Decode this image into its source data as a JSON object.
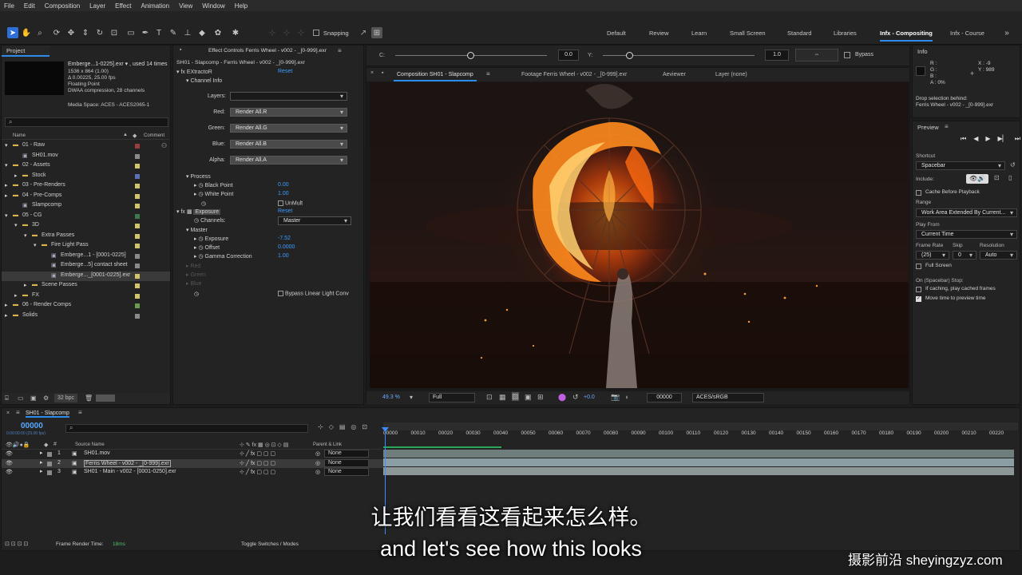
{
  "menu": [
    "File",
    "Edit",
    "Composition",
    "Layer",
    "Effect",
    "Animation",
    "View",
    "Window",
    "Help"
  ],
  "toolbar": {
    "snapping_label": "Snapping",
    "workspaces": [
      "Default",
      "Review",
      "Learn",
      "Small Screen",
      "Standard",
      "Libraries",
      "Infx - Compositing",
      "Infx - Course"
    ],
    "active_workspace": "Infx - Compositing"
  },
  "project": {
    "title": "Project",
    "item_name": "Emberge...1-0225].exr ▾ , used 14 times",
    "meta": [
      "1536 x 864 (1.00)",
      "Δ 0.00225, 25.00 fps",
      "Floating Point",
      "DWAA compression, 28 channels"
    ],
    "media_space": "Media Space: ACES - ACES2065-1",
    "search_placeholder": "",
    "col_name": "Name",
    "col_comment": "Comment",
    "bpc": "32 bpc",
    "tree": [
      {
        "label": "01 - Raw",
        "indent": 0,
        "type": "folder",
        "open": true,
        "color": "#9b3d3d"
      },
      {
        "label": "SH01.mov",
        "indent": 1,
        "type": "file",
        "color": "#8a8a8a"
      },
      {
        "label": "02 - Assets",
        "indent": 0,
        "type": "folder",
        "open": true,
        "color": "#d1c56a"
      },
      {
        "label": "Stock",
        "indent": 1,
        "type": "folder",
        "open": false,
        "color": "#5b6fb5"
      },
      {
        "label": "03 - Pre-Renders",
        "indent": 0,
        "type": "folder",
        "open": false,
        "color": "#d1c56a"
      },
      {
        "label": "04 - Pre-Comps",
        "indent": 0,
        "type": "folder",
        "open": false,
        "color": "#d1c56a"
      },
      {
        "label": "Slampcomp",
        "indent": 1,
        "type": "comp",
        "color": "#d1c56a"
      },
      {
        "label": "05 - CG",
        "indent": 0,
        "type": "folder",
        "open": true,
        "color": "#3b7a4e"
      },
      {
        "label": "3D",
        "indent": 1,
        "type": "folder",
        "open": true,
        "color": "#d1c56a"
      },
      {
        "label": "Extra Passes",
        "indent": 2,
        "type": "folder",
        "open": true,
        "color": "#d1c56a"
      },
      {
        "label": "Fire Light Pass",
        "indent": 3,
        "type": "folder",
        "open": true,
        "color": "#d1c56a"
      },
      {
        "label": "Emberge...1 - [0001-0225]",
        "indent": 4,
        "type": "file",
        "color": "#8a8a8a"
      },
      {
        "label": "Emberge...5] contact sheet",
        "indent": 4,
        "type": "file",
        "color": "#8a8a8a"
      },
      {
        "label": "Emberge..._[0001-0225].exr",
        "indent": 4,
        "type": "file",
        "color": "#d1c56a",
        "selected": true
      },
      {
        "label": "Scene Passes",
        "indent": 2,
        "type": "folder",
        "open": false,
        "color": "#d1c56a"
      },
      {
        "label": "FX",
        "indent": 1,
        "type": "folder",
        "open": false,
        "color": "#d1c56a"
      },
      {
        "label": "06 - Render Comps",
        "indent": 0,
        "type": "folder",
        "open": false,
        "color": "#6b9b4e"
      },
      {
        "label": "Solids",
        "indent": 0,
        "type": "folder",
        "open": false,
        "color": "#8a8a8a"
      }
    ]
  },
  "effect_controls": {
    "tab": "Effect Controls Ferris Wheel - v002 - _[0-999].exr",
    "subtitle": "SH01 - Slapcomp - Ferris Wheel - v002 - _[0-999].exr",
    "extractor_name": "EXtractoR",
    "reset": "Reset",
    "channel_info": "Channel Info",
    "layers_label": "Layers:",
    "layers_value": "",
    "red_label": "Red:",
    "red_value": "Render All.R",
    "green_label": "Green:",
    "green_value": "Render All.G",
    "blue_label": "Blue:",
    "blue_value": "Render All.B",
    "alpha_label": "Alpha:",
    "alpha_value": "Render All.A",
    "process": "Process",
    "black_point_label": "Black Point",
    "black_point": "0.00",
    "white_point_label": "White Point",
    "white_point": "1.00",
    "unmult": "UnMult",
    "exposure_name": "Exposure",
    "channels_label": "Channels:",
    "channels_value": "Master",
    "master": "Master",
    "exposure_label": "Exposure",
    "exposure": "-7.52",
    "offset_label": "Offset",
    "offset": "0.0000",
    "gamma_label": "Gamma Correction",
    "gamma": "1.00",
    "red": "Red",
    "green": "Green",
    "blue": "Blue",
    "bypass_linear": "Bypass Linear Light Conv"
  },
  "top_controls": {
    "c_label": "C:",
    "c_value": "0.0",
    "y_label": "Y:",
    "y_value": "1.0",
    "bypass": "Bypass"
  },
  "viewer_tabs": {
    "composition": "Composition SH01 - Slapcomp",
    "footage": "Footage Ferris Wheel - v002 - _[0-999].exr",
    "aeviewer": "Aeviewer",
    "layer": "Layer (none)"
  },
  "viewer_footer": {
    "zoom": "49.3 %",
    "resolution": "Full",
    "exposure": "+0.0",
    "timecode": "00000",
    "colorspace": "ACES/sRGB"
  },
  "info": {
    "title": "Info",
    "rgba": [
      "R :",
      "G :",
      "B :",
      "A : 0%"
    ],
    "x": "X : -9",
    "y": "Y : 989",
    "drop_hint": "Drop selection behind:",
    "drop_target": "Ferris Wheel - v002 - _[0-999].exr"
  },
  "preview": {
    "title": "Preview",
    "shortcut_label": "Shortcut",
    "shortcut": "Spacebar",
    "include_label": "Include:",
    "cache_before": "Cache Before Playback",
    "range_label": "Range",
    "range": "Work Area Extended By Current...",
    "play_from_label": "Play From",
    "play_from": "Current Time",
    "frame_rate_label": "Frame Rate",
    "skip_label": "Skip",
    "resolution_label": "Resolution",
    "frame_rate": "(25)",
    "skip": "0",
    "resolution": "Auto",
    "full_screen": "Full Screen",
    "on_stop": "On (Spacebar) Stop:",
    "if_caching": "If caching, play cached frames",
    "move_time": "Move time to preview time"
  },
  "timeline": {
    "tab": "SH01 - Slapcomp",
    "timecode": "00000",
    "timecode_sub": "0:00:00:00 (25.00 fps)",
    "source_name": "Source Name",
    "parent_link": "Parent & Link",
    "ticks": [
      "00000",
      "00010",
      "00020",
      "00030",
      "00040",
      "00050",
      "00060",
      "00070",
      "00080",
      "00090",
      "00100",
      "00110",
      "00120",
      "00130",
      "00140",
      "00150",
      "00160",
      "00170",
      "00180",
      "00190",
      "00200",
      "00210",
      "00220"
    ],
    "layers": [
      {
        "num": "1",
        "name": "SH01.mov",
        "parent": "None"
      },
      {
        "num": "2",
        "name": "Ferris Wheel - v002 - _[0-999].exr",
        "parent": "None",
        "selected": true
      },
      {
        "num": "3",
        "name": "SH01 - Main - v002 - [0001-0250].exr",
        "parent": "None"
      }
    ],
    "frame_render_label": "Frame Render Time:",
    "frame_render_value": "18ms",
    "toggle_label": "Toggle Switches / Modes"
  },
  "subtitles": {
    "chinese": "让我们看看这看起来怎么样。",
    "english": "and let's see how this looks"
  },
  "watermark": "摄影前沿 sheyingzyz.com"
}
